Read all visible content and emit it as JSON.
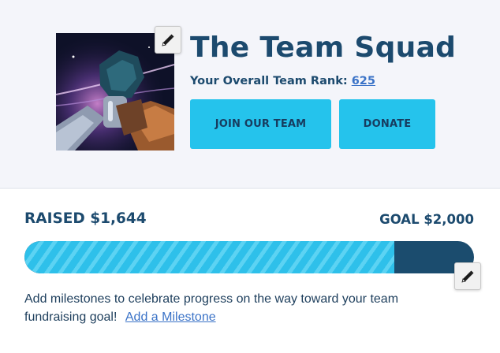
{
  "team": {
    "name": "The Team Squad",
    "rank_label": "Your Overall Team Rank:",
    "rank_value": "625",
    "image_alt": "team-avatar-handshake-illustration"
  },
  "actions": {
    "join_label": "JOIN OUR TEAM",
    "donate_label": "DONATE"
  },
  "fundraising": {
    "raised_label": "RAISED $1,644",
    "goal_label": "GOAL $2,000",
    "raised_amount": 1644,
    "goal_amount": 2000,
    "milestone_text": "Add milestones to celebrate progress on the way toward your team fundraising goal!",
    "milestone_link": "Add a Milestone"
  },
  "icons": {
    "image_edit": "pencil-icon",
    "goal_edit": "pencil-icon"
  },
  "colors": {
    "heading": "#1c4a6e",
    "accent": "#25c3ec",
    "link": "#3b73c7",
    "progress_track": "#1b4c6e",
    "hero_bg": "#f4f5fa"
  }
}
